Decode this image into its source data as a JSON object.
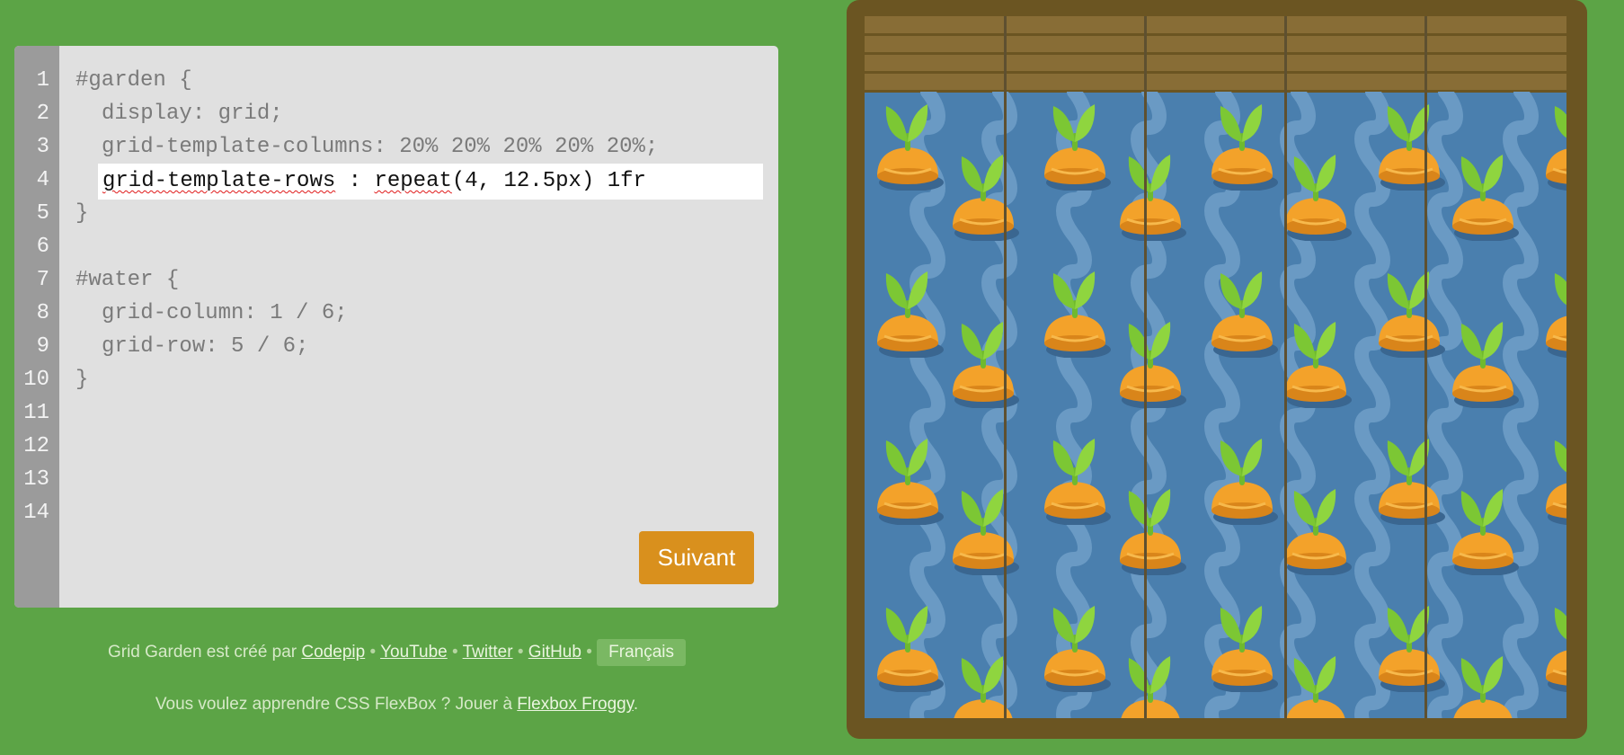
{
  "editor": {
    "line_numbers": [
      "1",
      "2",
      "3",
      "4",
      "5",
      "6",
      "7",
      "8",
      "9",
      "10",
      "11",
      "12",
      "13",
      "14"
    ],
    "line1": "#garden {",
    "line2": "display: grid;",
    "line3": "grid-template-columns: 20% 20% 20% 20% 20%;",
    "input_part1": "grid-template-rows",
    "input_part2": " : ",
    "input_part3": "repeat",
    "input_part4": "(4, 12.5px) 1fr",
    "line5": "}",
    "line7": "#water {",
    "line8": "grid-column: 1 / 6;",
    "line9": "grid-row: 5 / 6;",
    "line10": "}",
    "next_button": "Suivant"
  },
  "footer": {
    "credit_prefix": "Grid Garden est créé par ",
    "link_codepip": "Codepip",
    "link_youtube": "YouTube",
    "link_twitter": "Twitter",
    "link_github": "GitHub",
    "bullet": " • ",
    "language": "Français",
    "promo_prefix": "Vous voulez apprendre CSS FlexBox ? Jouer à ",
    "promo_link": "Flexbox Froggy",
    "promo_suffix": "."
  },
  "colors": {
    "background": "#5ca446",
    "water": "#4a7fae",
    "soil": "#886d36",
    "frame": "#6b5522",
    "button": "#d9901d"
  }
}
